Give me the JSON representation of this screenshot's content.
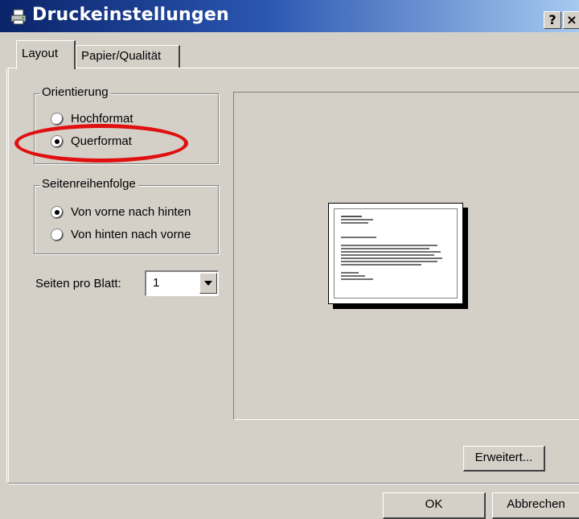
{
  "window": {
    "title": "Druckeinstellungen",
    "help_button": "?",
    "close_button": "×"
  },
  "tabs": [
    {
      "label": "Layout",
      "active": true
    },
    {
      "label": "Papier/Qualität",
      "active": false
    }
  ],
  "orientation": {
    "legend": "Orientierung",
    "options": [
      {
        "label": "Hochformat",
        "selected": false
      },
      {
        "label": "Querformat",
        "selected": true
      }
    ]
  },
  "page_order": {
    "legend": "Seitenreihenfolge",
    "options": [
      {
        "label": "Von vorne nach hinten",
        "selected": true
      },
      {
        "label": "Von hinten nach vorne",
        "selected": false
      }
    ]
  },
  "pages_per_sheet": {
    "label": "Seiten pro Blatt:",
    "value": "1"
  },
  "buttons": {
    "advanced": "Erweitert...",
    "ok": "OK",
    "cancel": "Abbrechen"
  },
  "icons": {
    "title": "printer-icon",
    "dropdown": "chevron-down-icon"
  },
  "colors": {
    "highlight": "#e01010",
    "titlebar_start": "#0a246a",
    "titlebar_end": "#a6caf0",
    "dialog_bg": "#d4d0c8"
  }
}
